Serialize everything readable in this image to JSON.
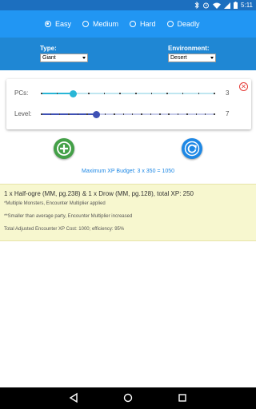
{
  "status_bar": {
    "time": "5:11",
    "icons": [
      "bluetooth-icon",
      "alarm-icon",
      "wifi-icon",
      "signal-icon",
      "battery-icon"
    ]
  },
  "difficulty": {
    "options": [
      {
        "label": "Easy",
        "selected": true
      },
      {
        "label": "Medium",
        "selected": false
      },
      {
        "label": "Hard",
        "selected": false
      },
      {
        "label": "Deadly",
        "selected": false
      }
    ]
  },
  "filters": {
    "type_label": "Type:",
    "type_value": "Giant",
    "environment_label": "Environment:",
    "environment_value": "Desert"
  },
  "sliders": {
    "pcs": {
      "label": "PCs:",
      "value": "3",
      "min": 1,
      "max": 12,
      "current": 3,
      "color": "#29b6d6"
    },
    "level": {
      "label": "Level:",
      "value": "7",
      "min": 1,
      "max": 20,
      "current": 7,
      "color": "#3f51b5"
    }
  },
  "actions": {
    "add_icon": "plus-circle-icon",
    "refresh_icon": "refresh-icon",
    "add_color": "#43a047",
    "refresh_color": "#1e88e5"
  },
  "budget_text": "Maximum XP Budget: 3 x 350 = 1050",
  "results": {
    "encounter": "1 x Half-ogre (MM, pg.238) & 1 x Drow (MM, pg.128), total XP: 250",
    "note_multiple": "*Multiple Monsters, Encounter Multiplier applied",
    "note_smaller": "**Smaller than average party, Encounter Multiplier increased",
    "total": "Total Adjusted Encounter XP Cost: 1000; efficiency: 95%"
  },
  "nav": {
    "back_icon": "back-icon",
    "home_icon": "home-icon",
    "recents_icon": "recents-icon"
  },
  "colors": {
    "primary": "#2196f3",
    "primary_dark": "#1c6fbf",
    "filter_bg": "#1f87d4",
    "results_bg": "#f7f7cf"
  }
}
